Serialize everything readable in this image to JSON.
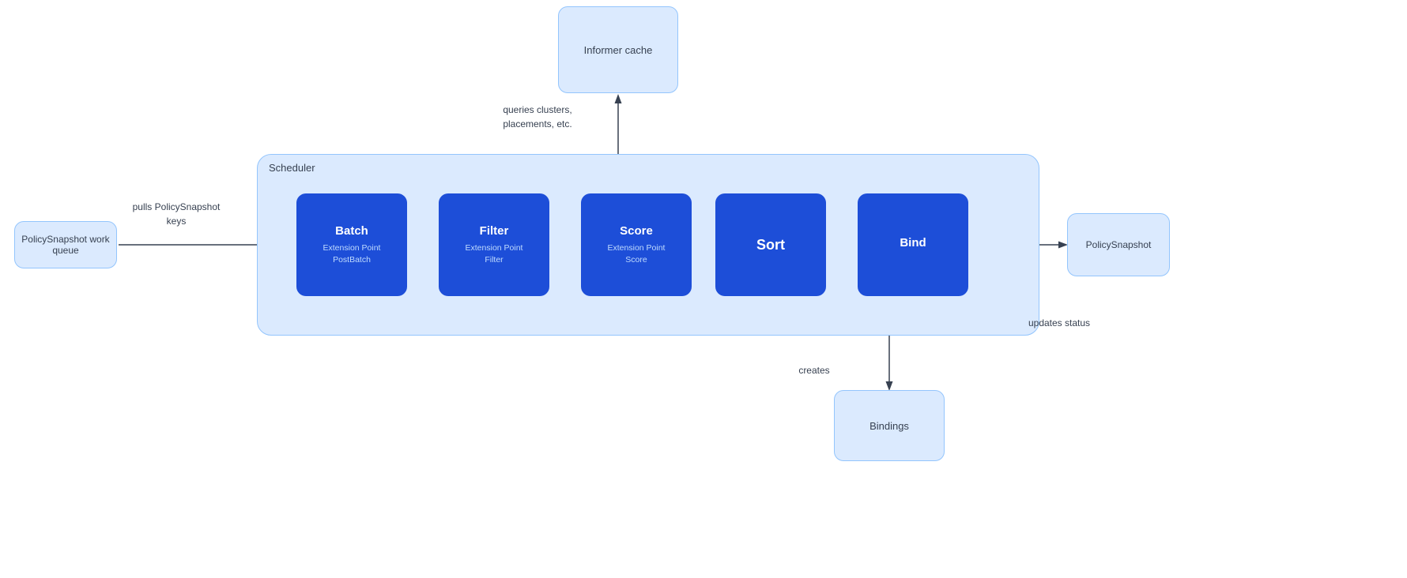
{
  "informer_cache": {
    "label": "Informer cache"
  },
  "policy_snapshot_queue": {
    "label": "PolicySnapshot work queue"
  },
  "policy_snapshot_out": {
    "label": "PolicySnapshot"
  },
  "bindings": {
    "label": "Bindings"
  },
  "scheduler": {
    "label": "Scheduler"
  },
  "stages": [
    {
      "id": "batch",
      "title": "Batch",
      "subtitle": "Extension Point\nPostBatch"
    },
    {
      "id": "filter",
      "title": "Filter",
      "subtitle": "Extension Point\nFilter"
    },
    {
      "id": "score",
      "title": "Score",
      "subtitle": "Extension Point\nScore"
    },
    {
      "id": "sort",
      "title": "Sort",
      "subtitle": ""
    },
    {
      "id": "bind",
      "title": "Bind",
      "subtitle": ""
    }
  ],
  "annotations": {
    "pulls": "pulls\nPolicySnapshot\nkeys",
    "queries": "queries\nclusters,\nplacements,\netc.",
    "creates": "creates",
    "updates_status": "updates\nstatus"
  }
}
